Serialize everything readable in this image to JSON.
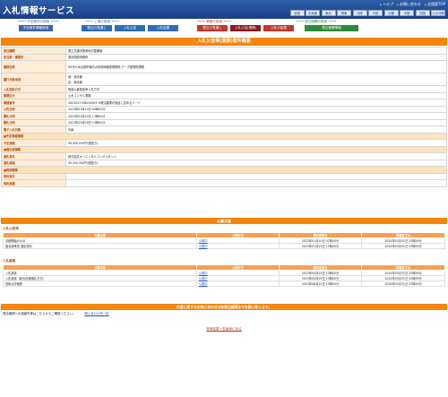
{
  "header": {
    "brand": "入札情報サービス",
    "links": [
      "ヘルプ",
      "お問い合わせ",
      "全国版TOP"
    ],
    "regions": [
      "全国",
      "北海道",
      "東北",
      "関東",
      "北陸",
      "中部",
      "近畿",
      "中国",
      "四国",
      "九州沖縄"
    ]
  },
  "nav": {
    "groups": [
      "予定案件の検索",
      "工事の検索",
      "業務の検索",
      "発注機関の検索"
    ],
    "tabs": [
      "予定案件情報検索",
      "発注の見通し",
      "入札公告",
      "入札結果",
      "発注の見通し",
      "入札公告(業務)",
      "入札の結果",
      "発注機関情報"
    ],
    "colors": {
      "plan": "#3f62a8",
      "construction": "#2e6fb8",
      "service": "#c0392b",
      "active": "#8b1a1a",
      "org": "#2a8c3a"
    }
  },
  "notice": {
    "title": "入札公告等(業務)案件概要",
    "rows": [
      {
        "label": "発注機関",
        "value": "国土交通省関東地方整備局"
      },
      {
        "label": "担当部・事務所",
        "value": "東京国道事務所"
      },
      {
        "label": "業務名称",
        "value": "R5代々木出張所管内大気常時観測業務他 データ整理他業務"
      },
      {
        "label": "履行対象地域",
        "value1": "他：東京都",
        "value2": "区：東京都"
      },
      {
        "label": "入札契約方式",
        "value": "簡易公募型競争入札方式"
      },
      {
        "label": "業務区分",
        "value": "土木コンサル業務"
      },
      {
        "label": "調達番号",
        "value": "2023031708020503    ※発注機関が独自に定めるコード"
      },
      {
        "label": "公告日時",
        "value": "2023年03月10日 00時00分"
      },
      {
        "label": "開札日時",
        "value": "2023年03月20日 13時00分"
      },
      {
        "label": "開札日時",
        "value": "2023年03月09日 13時00分"
      },
      {
        "label": "電子入札対象",
        "value": "対象"
      }
    ],
    "section_price": "■予定価格情報",
    "price_label": "予定価格",
    "price_value": "56,950,000円(税抜き)",
    "section_winner": "■落札者情報",
    "winner_name_label": "落札者名",
    "winner_name_value": "株式会社オリエンタルコンサルタンツ",
    "winner_amount_label": "落札価格",
    "winner_amount_value": "45,200,000円(税抜き)",
    "section_contract": "■契約情報",
    "contract_name_label": "契約者名",
    "contract_amount_label": "契約金額"
  },
  "documents": {
    "title": "公開文書",
    "cat1": "入札公告等",
    "cat2": "入札結果",
    "headers": [
      "文書名称",
      "公開状況",
      "最終更新日",
      "掲載終了日"
    ],
    "group1": [
      {
        "name": "手続開始の公示",
        "status": "公開中",
        "updated": "2023年01月10日 07時00分",
        "end": "2024年03月31日 23時59分"
      },
      {
        "name": "指名競争書 選定資料",
        "status": "公開中",
        "updated": "2023年01月23日 13時00分",
        "end": "2024年03月31日 23時59分"
      }
    ],
    "group2": [
      {
        "name": "入札調書",
        "status": "公開中",
        "updated": "2023年04月25日 13時00分",
        "end": "2024年03月31日 23時59分"
      },
      {
        "name": "入札調書（総合評価落札方式）",
        "status": "公開中",
        "updated": "2023年04月25日 13時00分",
        "end": "2024年03月31日 23時59分"
      },
      {
        "name": "技術点評価表",
        "status": "公開中",
        "updated": "2023年06月25日 13時00分",
        "end": "2024年03月31日 23時59分"
      }
    ]
  },
  "contact": {
    "title": "内容に関するお問い合わせは各発注機関までお願い致します。",
    "text": "発注機関への連絡先等はこちらからご確認ください。",
    "link": "問い合わせ先一覧"
  },
  "footer": {
    "back": "検索結果一覧画面に戻る"
  }
}
